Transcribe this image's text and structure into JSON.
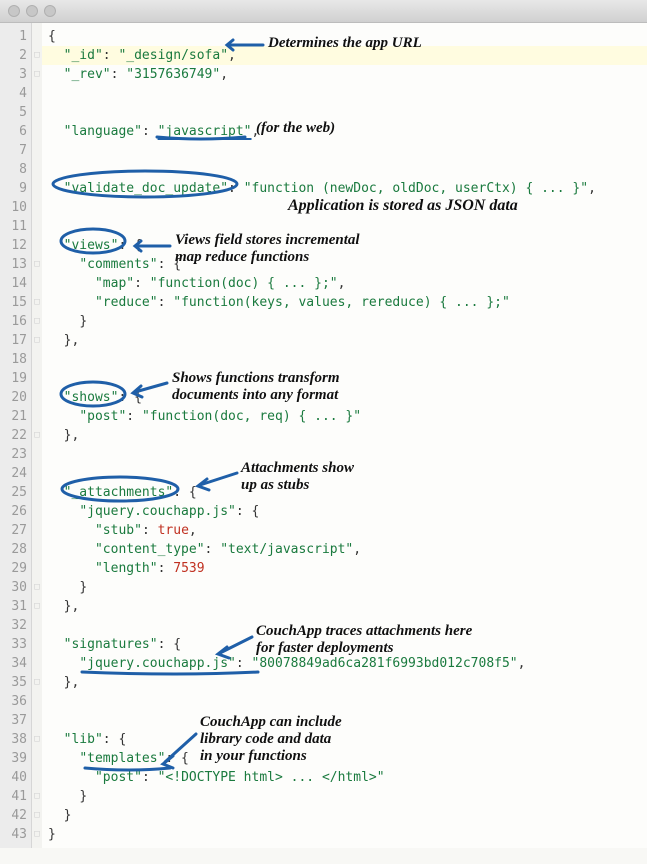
{
  "window": {
    "title": ""
  },
  "lines": {
    "total": 43,
    "foldable": [
      2,
      3,
      13,
      15,
      16,
      17,
      22,
      30,
      31,
      35,
      38,
      41,
      42,
      43
    ]
  },
  "code": {
    "l1": "{",
    "l2_k": "\"_id\"",
    "l2_v": "\"_design/sofa\"",
    "l3_k": "\"_rev\"",
    "l3_v": "\"3157636749\"",
    "l6_k": "\"language\"",
    "l6_v": "\"javascript\"",
    "l9_k": "\"validate_doc_update\"",
    "l9_v": "\"function (newDoc, oldDoc, userCtx) { ... }\"",
    "l12_k": "\"views\"",
    "l13_k": "\"comments\"",
    "l14_k": "\"map\"",
    "l14_v": "\"function(doc) { ... };\"",
    "l15_k": "\"reduce\"",
    "l15_v": "\"function(keys, values, rereduce) { ... };\"",
    "l20_k": "\"shows\"",
    "l21_k": "\"post\"",
    "l21_v": "\"function(doc, req) { ... }\"",
    "l25_k": "\"_attachments\"",
    "l26_k": "\"jquery.couchapp.js\"",
    "l27_k": "\"stub\"",
    "l27_v": "true",
    "l28_k": "\"content_type\"",
    "l28_v": "\"text/javascript\"",
    "l29_k": "\"length\"",
    "l29_v": "7539",
    "l33_k": "\"signatures\"",
    "l34_k": "\"jquery.couchapp.js\"",
    "l34_v": "\"80078849ad6ca281f6993bd012c708f5\"",
    "l38_k": "\"lib\"",
    "l39_k": "\"templates\"",
    "l40_k": "\"post\"",
    "l40_v": "\"<!DOCTYPE html> ... </html>\"",
    "close_brace": "}",
    "close_brace_comma": "},",
    "colon_open": ": {",
    "colon": ": ",
    "comma": ","
  },
  "annotations": {
    "a1": "Determines the app URL",
    "a2": "(for the web)",
    "a3": "Application is stored as JSON data",
    "a4": "Views field stores incremental\nmap reduce functions",
    "a5": "Shows functions transform\ndocuments into any format",
    "a6": "Attachments show\nup as stubs",
    "a7": "CouchApp traces attachments here\nfor faster deployments",
    "a8": "CouchApp can include\nlibrary code and data\nin your functions"
  }
}
